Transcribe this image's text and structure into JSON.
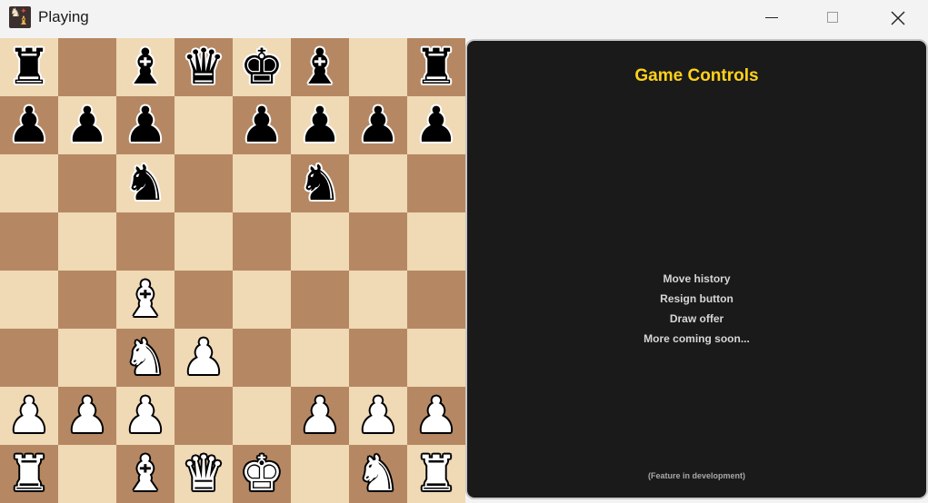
{
  "window": {
    "title": "Playing",
    "icon": "chess-app-icon"
  },
  "board": {
    "light_color": "#f0d9b5",
    "dark_color": "#b58863",
    "rows": [
      [
        "bR",
        "",
        "bB",
        "bQ",
        "bK",
        "bB",
        "",
        "bR"
      ],
      [
        "bP",
        "bP",
        "bP",
        "",
        "bP",
        "bP",
        "bP",
        "bP"
      ],
      [
        "",
        "",
        "bN",
        "",
        "",
        "bN",
        "",
        ""
      ],
      [
        "",
        "",
        "",
        "",
        "",
        "",
        "",
        ""
      ],
      [
        "",
        "",
        "wB",
        "",
        "",
        "",
        "",
        ""
      ],
      [
        "",
        "",
        "wN",
        "wP",
        "",
        "",
        "",
        ""
      ],
      [
        "wP",
        "wP",
        "wP",
        "",
        "",
        "wP",
        "wP",
        "wP"
      ],
      [
        "wR",
        "",
        "wB",
        "wQ",
        "wK",
        "",
        "wN",
        "wR"
      ]
    ]
  },
  "panel": {
    "title": "Game Controls",
    "title_color": "#ffd21a",
    "features": [
      "Move history",
      "Resign button",
      "Draw offer",
      "More coming soon..."
    ],
    "footer": "(Feature in development)"
  }
}
